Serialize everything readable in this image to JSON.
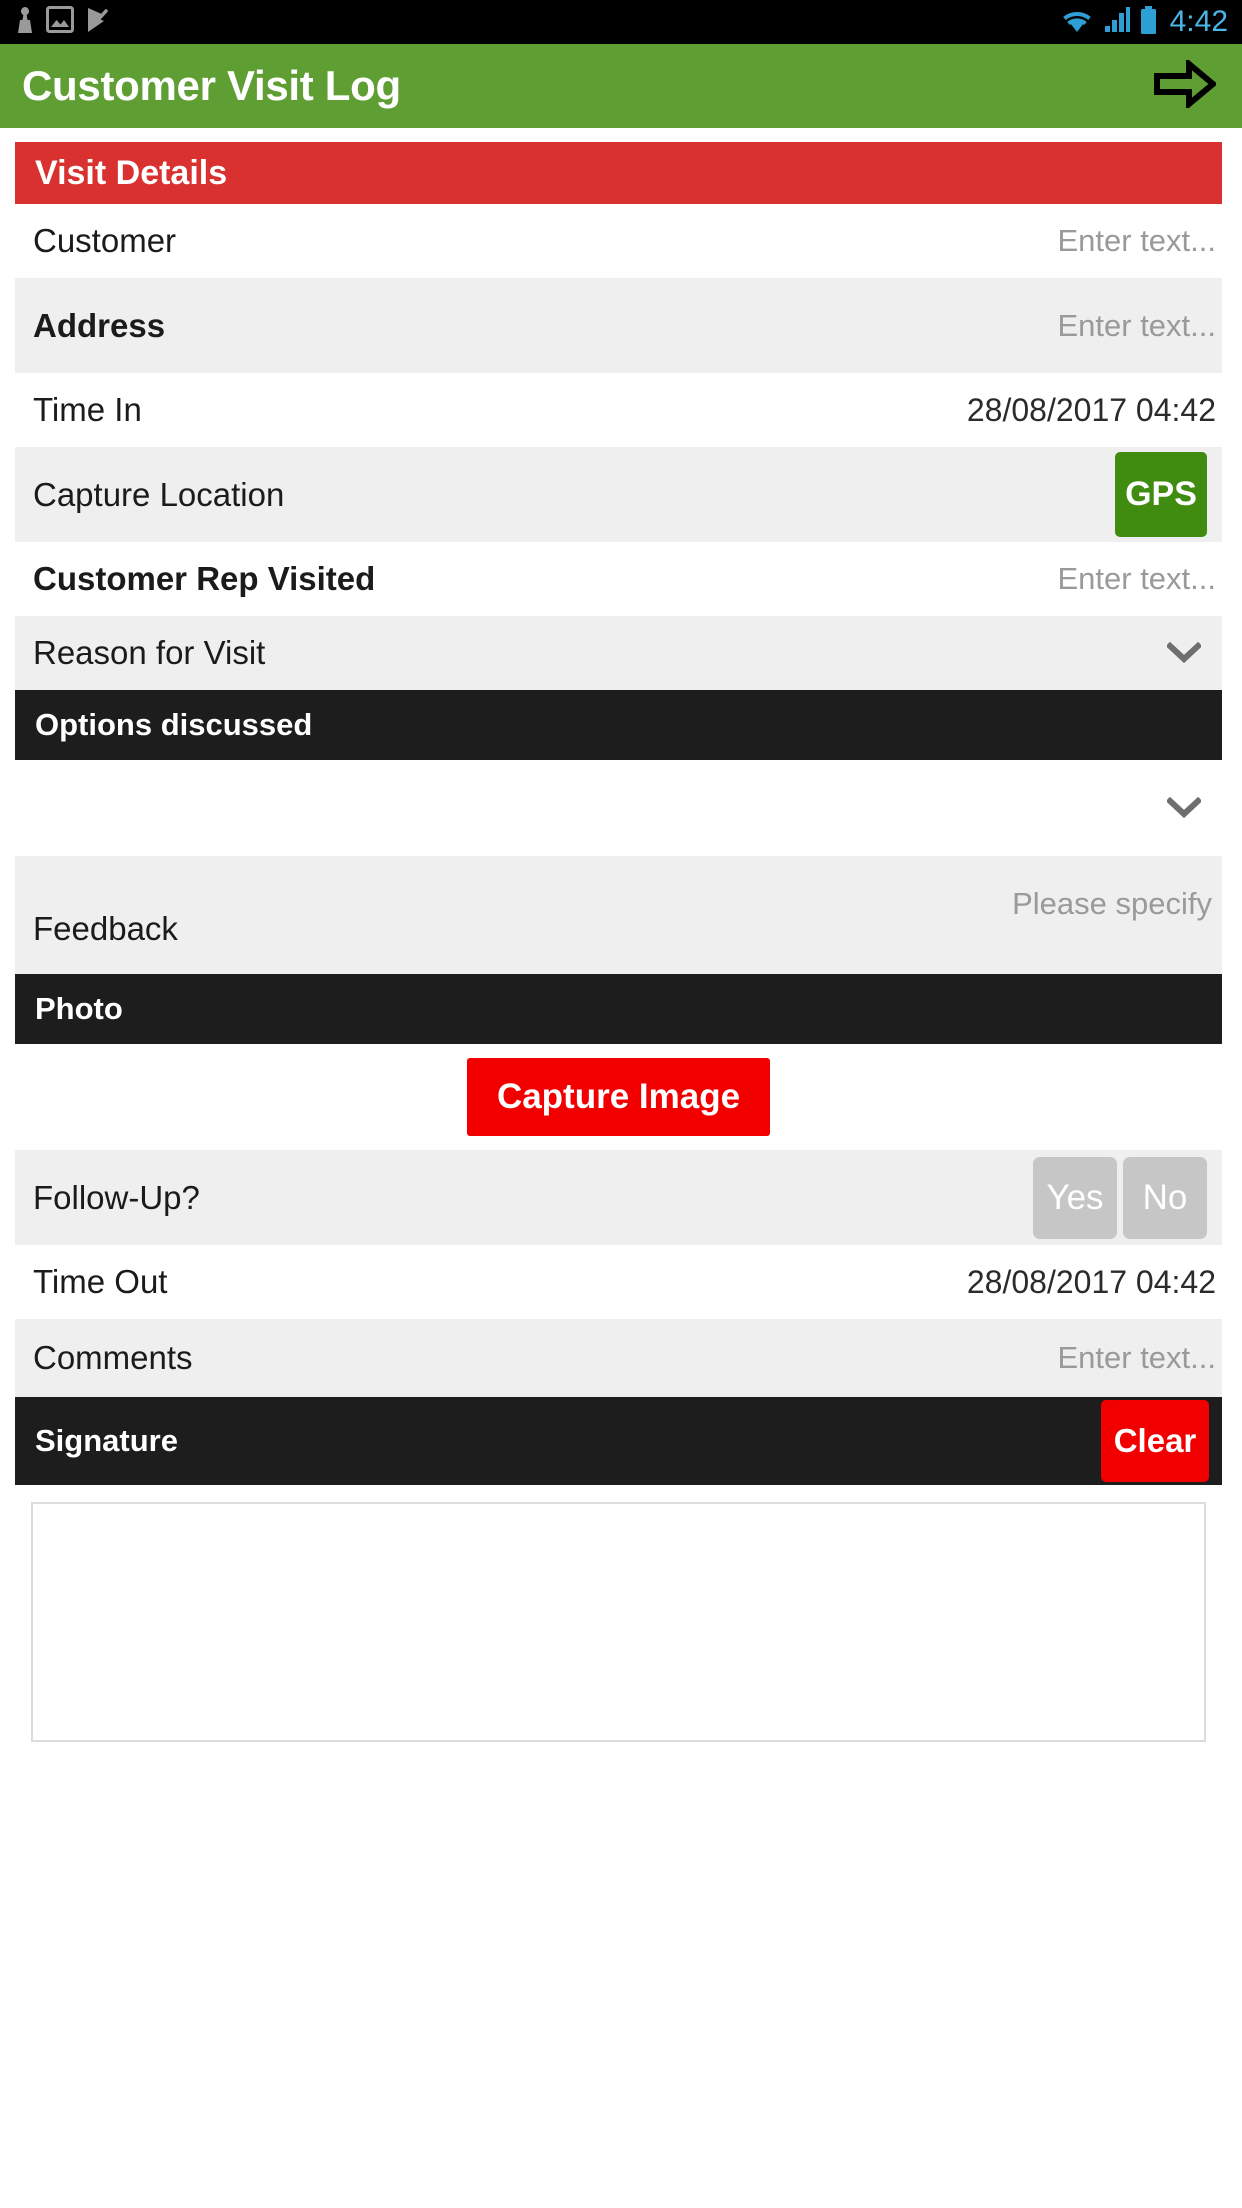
{
  "status_bar": {
    "icons_left": [
      "person-icon",
      "image-icon",
      "checkmark-flag-icon"
    ],
    "icons_right": [
      "wifi-icon",
      "signal-icon",
      "battery-icon"
    ],
    "clock": "4:42",
    "accent_color": "#4bb6e8",
    "background": "#000000"
  },
  "app_bar": {
    "title": "Customer Visit Log",
    "forward_icon": "arrow-right-icon",
    "background": "#5e9e33"
  },
  "sections": {
    "visit_details": {
      "label": "Visit Details",
      "color": "#d8312f"
    },
    "options_discussed": {
      "label": "Options discussed",
      "color": "#1d1d1d"
    },
    "photo": {
      "label": "Photo",
      "color": "#1d1d1d"
    },
    "signature": {
      "label": "Signature",
      "color": "#1d1d1d",
      "clear_label": "Clear",
      "clear_color": "#f20000"
    }
  },
  "fields": {
    "customer": {
      "label": "Customer",
      "placeholder": "Enter text..."
    },
    "address": {
      "label": "Address",
      "placeholder": "Enter text..."
    },
    "time_in": {
      "label": "Time In",
      "value": "28/08/2017 04:42"
    },
    "capture_location": {
      "label": "Capture Location",
      "button_label": "GPS",
      "button_color": "#3f8c11"
    },
    "customer_rep_visited": {
      "label": "Customer Rep Visited",
      "placeholder": "Enter text..."
    },
    "reason_for_visit": {
      "label": "Reason for Visit",
      "icon": "chevron-down-icon"
    },
    "options_dropdown": {
      "label": "",
      "icon": "chevron-down-icon"
    },
    "feedback": {
      "label": "Feedback",
      "placeholder": "Please specify"
    },
    "capture_image": {
      "label": "Capture Image",
      "color": "#f20000"
    },
    "follow_up": {
      "label": "Follow-Up?",
      "yes_label": "Yes",
      "no_label": "No"
    },
    "time_out": {
      "label": "Time Out",
      "value": "28/08/2017 04:42"
    },
    "comments": {
      "label": "Comments",
      "placeholder": "Enter text..."
    }
  }
}
